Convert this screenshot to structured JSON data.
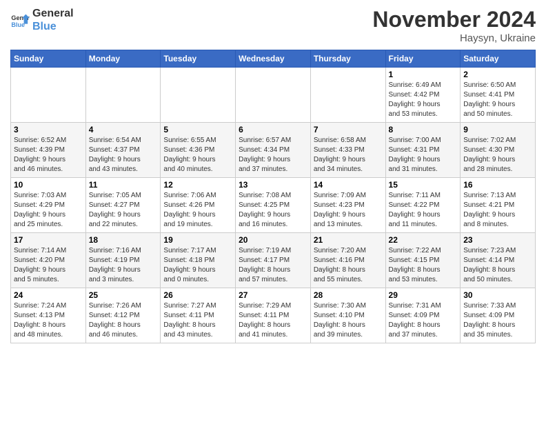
{
  "header": {
    "logo_line1": "General",
    "logo_line2": "Blue",
    "month": "November 2024",
    "location": "Haysyn, Ukraine"
  },
  "weekdays": [
    "Sunday",
    "Monday",
    "Tuesday",
    "Wednesday",
    "Thursday",
    "Friday",
    "Saturday"
  ],
  "weeks": [
    [
      {
        "day": "",
        "info": ""
      },
      {
        "day": "",
        "info": ""
      },
      {
        "day": "",
        "info": ""
      },
      {
        "day": "",
        "info": ""
      },
      {
        "day": "",
        "info": ""
      },
      {
        "day": "1",
        "info": "Sunrise: 6:49 AM\nSunset: 4:42 PM\nDaylight: 9 hours\nand 53 minutes."
      },
      {
        "day": "2",
        "info": "Sunrise: 6:50 AM\nSunset: 4:41 PM\nDaylight: 9 hours\nand 50 minutes."
      }
    ],
    [
      {
        "day": "3",
        "info": "Sunrise: 6:52 AM\nSunset: 4:39 PM\nDaylight: 9 hours\nand 46 minutes."
      },
      {
        "day": "4",
        "info": "Sunrise: 6:54 AM\nSunset: 4:37 PM\nDaylight: 9 hours\nand 43 minutes."
      },
      {
        "day": "5",
        "info": "Sunrise: 6:55 AM\nSunset: 4:36 PM\nDaylight: 9 hours\nand 40 minutes."
      },
      {
        "day": "6",
        "info": "Sunrise: 6:57 AM\nSunset: 4:34 PM\nDaylight: 9 hours\nand 37 minutes."
      },
      {
        "day": "7",
        "info": "Sunrise: 6:58 AM\nSunset: 4:33 PM\nDaylight: 9 hours\nand 34 minutes."
      },
      {
        "day": "8",
        "info": "Sunrise: 7:00 AM\nSunset: 4:31 PM\nDaylight: 9 hours\nand 31 minutes."
      },
      {
        "day": "9",
        "info": "Sunrise: 7:02 AM\nSunset: 4:30 PM\nDaylight: 9 hours\nand 28 minutes."
      }
    ],
    [
      {
        "day": "10",
        "info": "Sunrise: 7:03 AM\nSunset: 4:29 PM\nDaylight: 9 hours\nand 25 minutes."
      },
      {
        "day": "11",
        "info": "Sunrise: 7:05 AM\nSunset: 4:27 PM\nDaylight: 9 hours\nand 22 minutes."
      },
      {
        "day": "12",
        "info": "Sunrise: 7:06 AM\nSunset: 4:26 PM\nDaylight: 9 hours\nand 19 minutes."
      },
      {
        "day": "13",
        "info": "Sunrise: 7:08 AM\nSunset: 4:25 PM\nDaylight: 9 hours\nand 16 minutes."
      },
      {
        "day": "14",
        "info": "Sunrise: 7:09 AM\nSunset: 4:23 PM\nDaylight: 9 hours\nand 13 minutes."
      },
      {
        "day": "15",
        "info": "Sunrise: 7:11 AM\nSunset: 4:22 PM\nDaylight: 9 hours\nand 11 minutes."
      },
      {
        "day": "16",
        "info": "Sunrise: 7:13 AM\nSunset: 4:21 PM\nDaylight: 9 hours\nand 8 minutes."
      }
    ],
    [
      {
        "day": "17",
        "info": "Sunrise: 7:14 AM\nSunset: 4:20 PM\nDaylight: 9 hours\nand 5 minutes."
      },
      {
        "day": "18",
        "info": "Sunrise: 7:16 AM\nSunset: 4:19 PM\nDaylight: 9 hours\nand 3 minutes."
      },
      {
        "day": "19",
        "info": "Sunrise: 7:17 AM\nSunset: 4:18 PM\nDaylight: 9 hours\nand 0 minutes."
      },
      {
        "day": "20",
        "info": "Sunrise: 7:19 AM\nSunset: 4:17 PM\nDaylight: 8 hours\nand 57 minutes."
      },
      {
        "day": "21",
        "info": "Sunrise: 7:20 AM\nSunset: 4:16 PM\nDaylight: 8 hours\nand 55 minutes."
      },
      {
        "day": "22",
        "info": "Sunrise: 7:22 AM\nSunset: 4:15 PM\nDaylight: 8 hours\nand 53 minutes."
      },
      {
        "day": "23",
        "info": "Sunrise: 7:23 AM\nSunset: 4:14 PM\nDaylight: 8 hours\nand 50 minutes."
      }
    ],
    [
      {
        "day": "24",
        "info": "Sunrise: 7:24 AM\nSunset: 4:13 PM\nDaylight: 8 hours\nand 48 minutes."
      },
      {
        "day": "25",
        "info": "Sunrise: 7:26 AM\nSunset: 4:12 PM\nDaylight: 8 hours\nand 46 minutes."
      },
      {
        "day": "26",
        "info": "Sunrise: 7:27 AM\nSunset: 4:11 PM\nDaylight: 8 hours\nand 43 minutes."
      },
      {
        "day": "27",
        "info": "Sunrise: 7:29 AM\nSunset: 4:11 PM\nDaylight: 8 hours\nand 41 minutes."
      },
      {
        "day": "28",
        "info": "Sunrise: 7:30 AM\nSunset: 4:10 PM\nDaylight: 8 hours\nand 39 minutes."
      },
      {
        "day": "29",
        "info": "Sunrise: 7:31 AM\nSunset: 4:09 PM\nDaylight: 8 hours\nand 37 minutes."
      },
      {
        "day": "30",
        "info": "Sunrise: 7:33 AM\nSunset: 4:09 PM\nDaylight: 8 hours\nand 35 minutes."
      }
    ]
  ]
}
